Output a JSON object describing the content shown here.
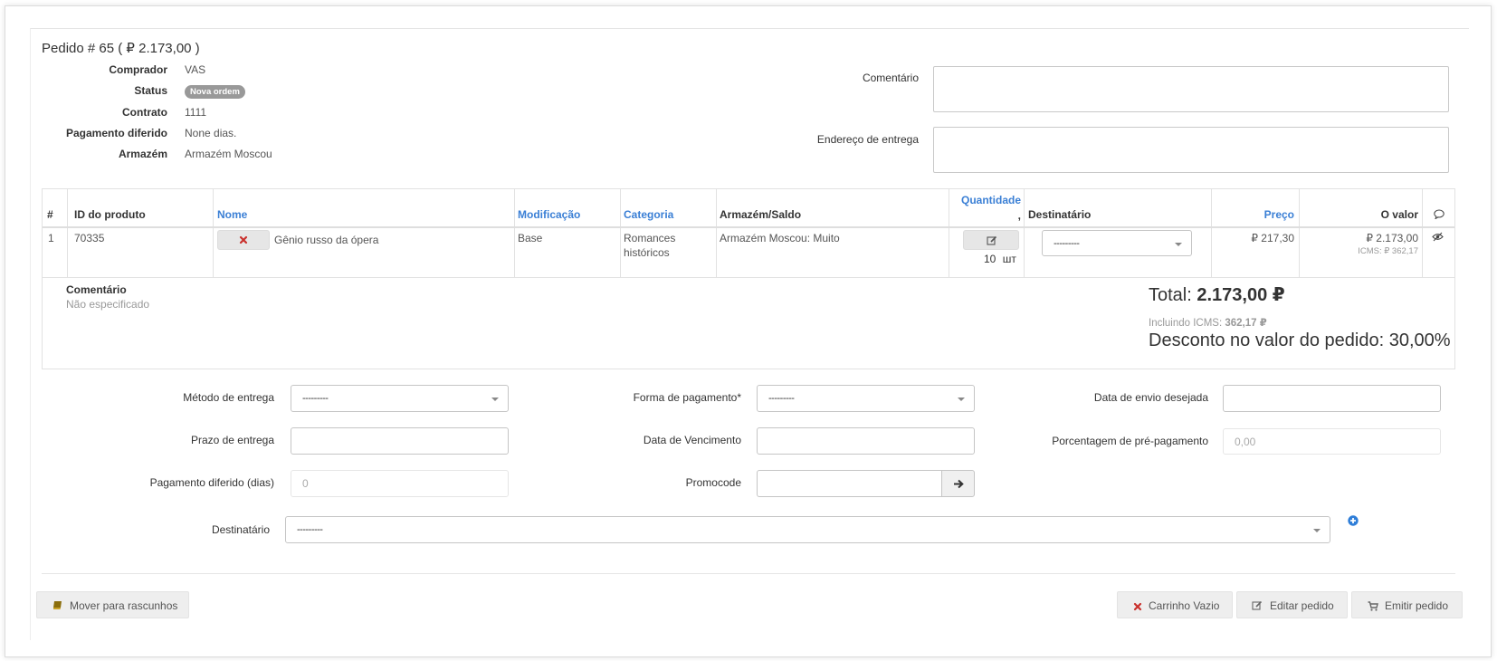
{
  "order": {
    "title": "Pedido # 65 ( ₽ 2.173,00 )",
    "info": [
      {
        "label": "Comprador",
        "value": "VAS"
      },
      {
        "label": "Status",
        "badge": "Nova ordem"
      },
      {
        "label": "Contrato",
        "value": "1111"
      },
      {
        "label": "Pagamento diferido",
        "value": "None dias."
      },
      {
        "label": "Armazém",
        "value": "Armazém Moscou"
      }
    ],
    "comment_label": "Comentário",
    "address_label": "Endereço de entrega"
  },
  "table": {
    "headers": {
      "num": "#",
      "product_id": "ID do produto",
      "name": "Nome",
      "modification": "Modificação",
      "category": "Categoria",
      "warehouse_stock": "Armazém/Saldo",
      "quantity": "Quantidade",
      "quantity_sub": ",",
      "recipient": "Destinatário",
      "price": "Preço",
      "value": "O valor"
    },
    "rows": [
      {
        "num": "1",
        "product_id": "70335",
        "name": "Gênio russo da ópera",
        "modification": "Base",
        "category_line1": "Romances",
        "category_line2": "históricos",
        "warehouse_stock": "Armazém Moscou: Muito",
        "quantity": "10",
        "unit": "шт",
        "recipient": "---------",
        "price": "₽ 217,30",
        "value": "₽ 2.173,00",
        "icms": "ICMS: ₽ 362,17"
      }
    ],
    "comment_title": "Comentário",
    "comment_value": "Não especificado"
  },
  "totals": {
    "total_label": "Total: ",
    "total_value": "2.173,00 ₽",
    "icms_label": "Incluindo ICMS: ",
    "icms_value": "362,17 ₽",
    "discount": "Desconto no valor do pedido: 30,00%"
  },
  "form": {
    "delivery_method_label": "Método de entrega",
    "delivery_method_value": "---------",
    "payment_form_label": "Forma de pagamento*",
    "payment_form_value": "---------",
    "desired_ship_date_label": "Data de envio desejada",
    "delivery_term_label": "Prazo de entrega",
    "due_date_label": "Data de Vencimento",
    "prepayment_label": "Porcentagem de pré-pagamento",
    "prepayment_placeholder": "0,00",
    "deferred_payment_label": "Pagamento diferido (dias)",
    "deferred_payment_placeholder": "0",
    "promocode_label": "Promocode",
    "recipient_label": "Destinatário",
    "recipient_value": "---------"
  },
  "footer": {
    "move_to_drafts": "Mover para rascunhos",
    "empty_cart": "Carrinho Vazio",
    "edit_order": "Editar pedido",
    "issue_order": "Emitir pedido"
  },
  "colors": {
    "link": "#3a7fd5",
    "danger": "#c9302c",
    "badge": "#999999",
    "accent_plus": "#2f7ed8"
  }
}
